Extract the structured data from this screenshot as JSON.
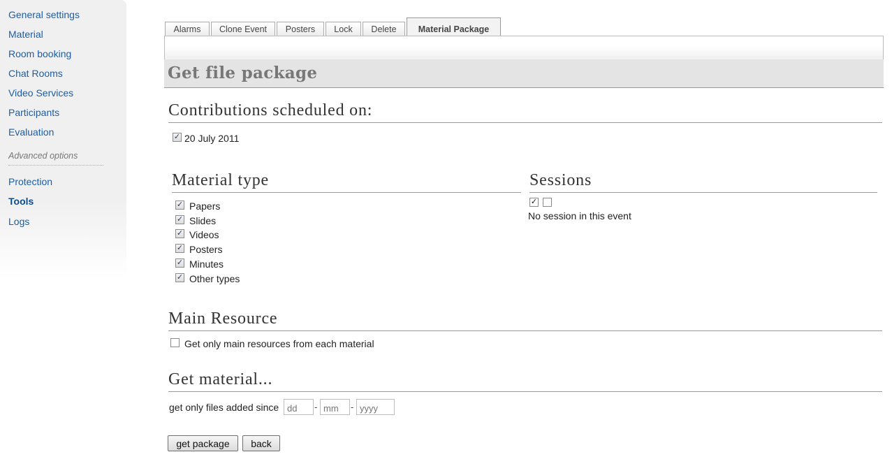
{
  "sidebar": {
    "items": [
      {
        "label": "General settings"
      },
      {
        "label": "Material"
      },
      {
        "label": "Room booking"
      },
      {
        "label": "Chat Rooms"
      },
      {
        "label": "Video Services"
      },
      {
        "label": "Participants"
      },
      {
        "label": "Evaluation"
      }
    ],
    "advanced_label": "Advanced options",
    "advanced_items": [
      {
        "label": "Protection"
      },
      {
        "label": "Tools"
      },
      {
        "label": "Logs"
      }
    ],
    "active": "Tools"
  },
  "tabs": [
    {
      "label": "Alarms"
    },
    {
      "label": "Clone Event"
    },
    {
      "label": "Posters"
    },
    {
      "label": "Lock"
    },
    {
      "label": "Delete"
    },
    {
      "label": "Material Package"
    }
  ],
  "active_tab": "Material Package",
  "page_title": "Get file package",
  "contributions": {
    "title": "Contributions scheduled on:",
    "dates": [
      {
        "label": "20 July 2011",
        "checked": true
      }
    ]
  },
  "material_type": {
    "title": "Material type",
    "items": [
      {
        "label": "Papers",
        "checked": true
      },
      {
        "label": "Slides",
        "checked": true
      },
      {
        "label": "Videos",
        "checked": true
      },
      {
        "label": "Posters",
        "checked": true
      },
      {
        "label": "Minutes",
        "checked": true
      },
      {
        "label": "Other types",
        "checked": true
      }
    ]
  },
  "sessions": {
    "title": "Sessions",
    "select_all_checked": true,
    "select_none_checked": false,
    "empty_text": "No session in this event"
  },
  "main_resource": {
    "title": "Main Resource",
    "option_label": "Get only main resources from each material",
    "checked": false
  },
  "get_material": {
    "title": "Get material...",
    "since_label": "get only files added since",
    "day_placeholder": "dd",
    "month_placeholder": "mm",
    "year_placeholder": "yyyy",
    "separator": "-"
  },
  "buttons": {
    "get_package": "get package",
    "back": "back"
  },
  "check_glyph": "✓"
}
